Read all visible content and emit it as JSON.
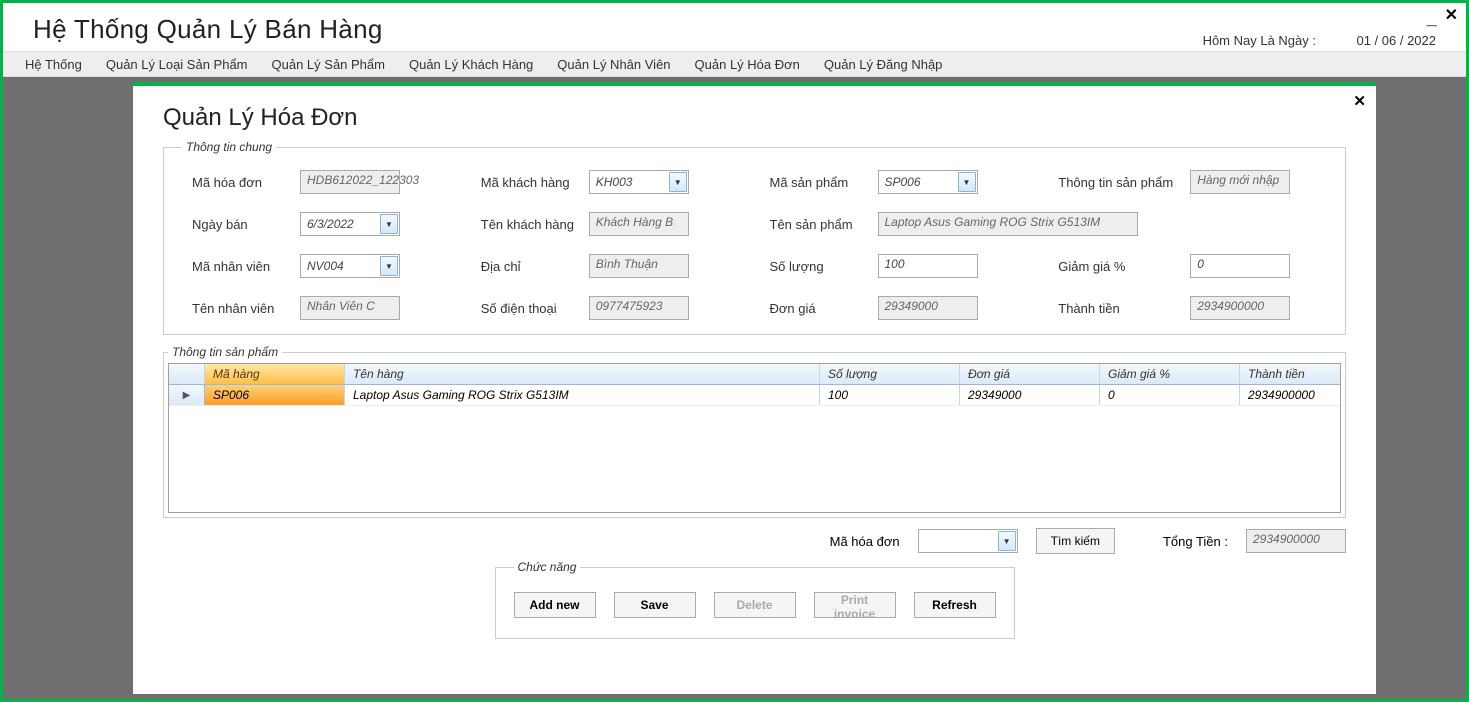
{
  "app": {
    "title": "Hệ Thống Quản Lý Bán Hàng",
    "today_label": "Hôm Nay Là Ngày :",
    "today_date": "01 / 06 / 2022"
  },
  "menu": {
    "items": [
      "Hệ Thống",
      "Quản Lý Loại Sản Phẩm",
      "Quản Lý Sản Phẩm",
      "Quản Lý Khách Hàng",
      "Quản Lý Nhân Viên",
      "Quản Lý Hóa Đơn",
      "Quản Lý Đăng Nhập"
    ]
  },
  "page": {
    "title": "Quản Lý Hóa Đơn",
    "group_general": "Thông tin chung",
    "group_product": "Thông tin sản phẩm",
    "group_func": "Chức năng"
  },
  "fields": {
    "ma_hoa_don": {
      "label": "Mã hóa đơn",
      "value": "HDB612022_122303"
    },
    "ngay_ban": {
      "label": "Ngày bán",
      "value": "6/3/2022"
    },
    "ma_nhan_vien": {
      "label": "Mã nhân viên",
      "value": "NV004"
    },
    "ten_nhan_vien": {
      "label": "Tên nhân viên",
      "value": "Nhân Viên C"
    },
    "ma_khach_hang": {
      "label": "Mã khách hàng",
      "value": "KH003"
    },
    "ten_khach_hang": {
      "label": "Tên khách hàng",
      "value": "Khách Hàng B"
    },
    "dia_chi": {
      "label": "Địa chỉ",
      "value": "Bình Thuận"
    },
    "so_dien_thoai": {
      "label": "Số điện thoại",
      "value": "0977475923"
    },
    "ma_san_pham": {
      "label": "Mã sản phẩm",
      "value": "SP006"
    },
    "ten_san_pham": {
      "label": "Tên sản phẩm",
      "value": "Laptop Asus Gaming ROG Strix G513IM"
    },
    "so_luong": {
      "label": "Số lượng",
      "value": "100"
    },
    "don_gia": {
      "label": "Đơn giá",
      "value": "29349000"
    },
    "thong_tin_sp": {
      "label": "Thông tin sản phẩm",
      "value": "Hàng mới nhập"
    },
    "giam_gia": {
      "label": "Giảm giá %",
      "value": "0"
    },
    "thanh_tien": {
      "label": "Thành tiền",
      "value": "2934900000"
    }
  },
  "grid": {
    "headers": {
      "ma_hang": "Mã hàng",
      "ten_hang": "Tên hàng",
      "so_luong": "Số lượng",
      "don_gia": "Đơn giá",
      "giam_gia": "Giảm giá %",
      "thanh_tien": "Thành tiền"
    },
    "rows": [
      {
        "ma": "SP006",
        "ten": "Laptop Asus Gaming ROG Strix G513IM",
        "sl": "100",
        "dg": "29349000",
        "gg": "0",
        "tt": "2934900000"
      }
    ]
  },
  "search": {
    "label": "Mã hóa đơn",
    "value": "",
    "button": "Tìm kiếm",
    "total_label": "Tổng Tiền :",
    "total_value": "2934900000"
  },
  "buttons": {
    "add": "Add new",
    "save": "Save",
    "delete": "Delete",
    "print": "Print invoice",
    "refresh": "Refresh"
  }
}
